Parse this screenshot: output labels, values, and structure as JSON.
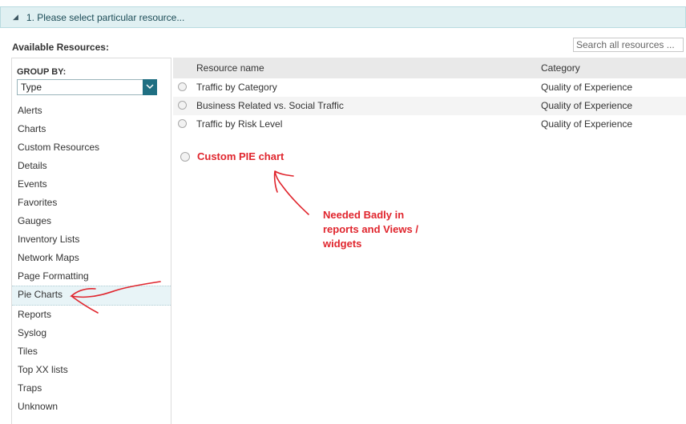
{
  "step_bar": {
    "caret": "◢",
    "text": "1. Please select particular resource..."
  },
  "available_label": "Available Resources:",
  "search": {
    "placeholder": "Search all resources ..."
  },
  "group_by": {
    "label": "GROUP BY:",
    "value": "Type",
    "chevron": "chevron-down-icon"
  },
  "types": [
    "Alerts",
    "Charts",
    "Custom Resources",
    "Details",
    "Events",
    "Favorites",
    "Gauges",
    "Inventory Lists",
    "Network Maps",
    "Page Formatting",
    "Pie Charts",
    "Reports",
    "Syslog",
    "Tiles",
    "Top XX lists",
    "Traps",
    "Unknown"
  ],
  "selected_type": "Pie Charts",
  "grid": {
    "headers": {
      "name": "Resource name",
      "category": "Category"
    },
    "rows": [
      {
        "name": "Traffic by Category",
        "category": "Quality of Experience"
      },
      {
        "name": "Business Related vs. Social Traffic",
        "category": "Quality of Experience"
      },
      {
        "name": "Traffic by Risk Level",
        "category": "Quality of Experience"
      }
    ]
  },
  "custom_resource": {
    "label": "Custom PIE chart"
  },
  "annotation_note": {
    "line1": "Needed Badly in",
    "line2": "reports and Views /",
    "line3": "widgets"
  },
  "colors": {
    "annotation_red": "#e0252d",
    "accent_teal": "#1f6f82",
    "step_bg": "#e0f0f2"
  }
}
